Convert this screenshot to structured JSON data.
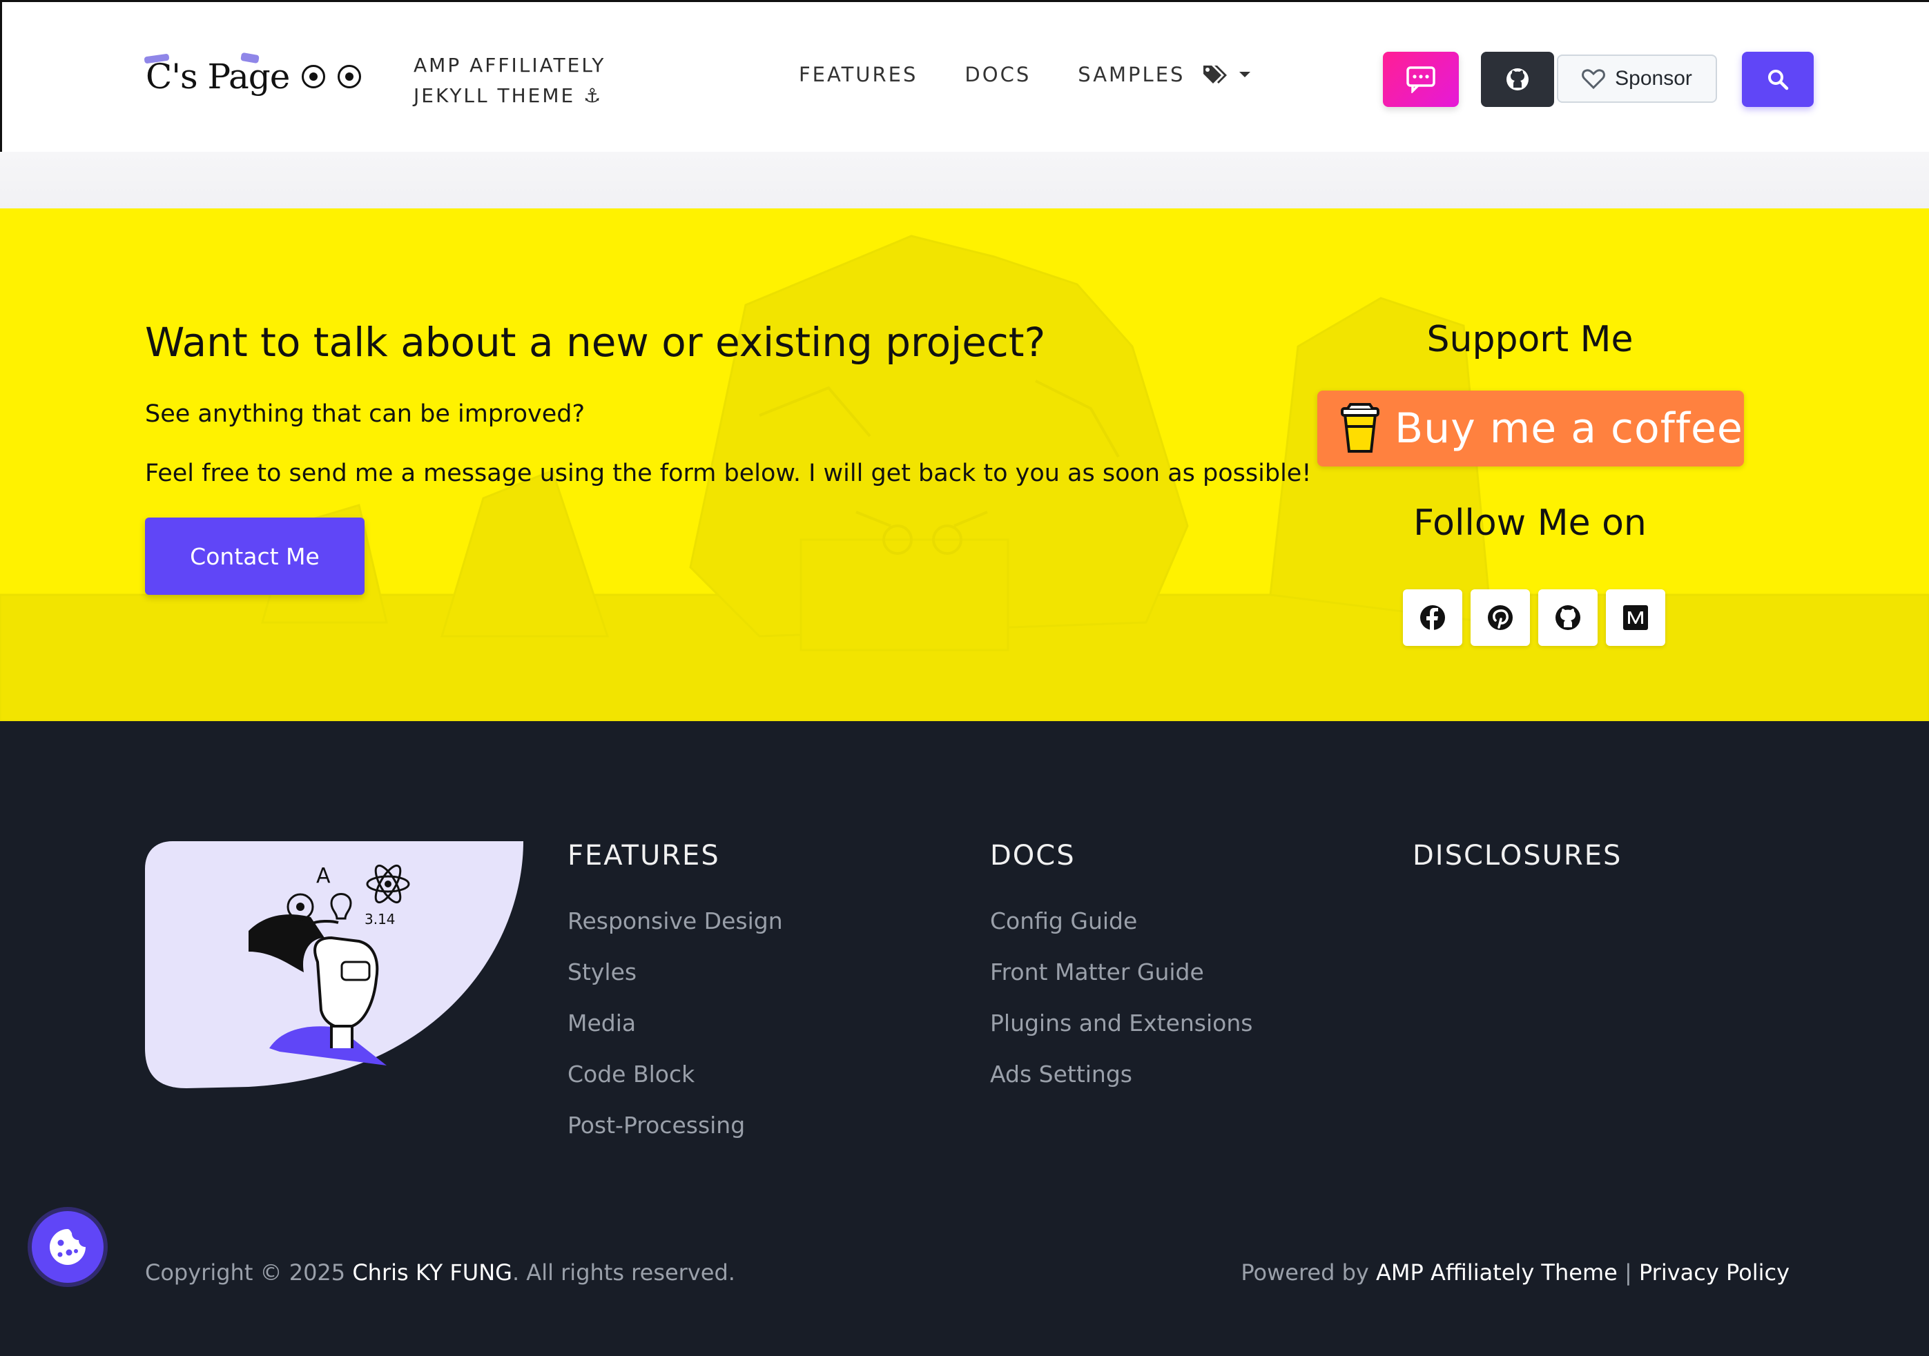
{
  "header": {
    "logo_text": "C's Page",
    "tagline_line1": "AMP AFFILIATELY",
    "tagline_line2": "JEKYLL THEME ⚓",
    "nav": [
      {
        "label": "FEATURES"
      },
      {
        "label": "DOCS"
      },
      {
        "label": "SAMPLES"
      }
    ],
    "sponsor_label": "Sponsor",
    "icons": {
      "tags": "tags-icon",
      "chat": "chat-icon",
      "github": "github-icon",
      "heart": "heart-icon",
      "search": "search-icon"
    }
  },
  "hero": {
    "title": "Want to talk about a new or existing project?",
    "line1": "See anything that can be improved?",
    "line2": "Feel free to send me a message using the form below. I will get back to you as soon as possible!",
    "contact_label": "Contact Me",
    "support_title": "Support Me",
    "coffee_label": "Buy me a coffee",
    "follow_title": "Follow Me on",
    "social": [
      "facebook-icon",
      "pinterest-icon",
      "github-icon",
      "medium-icon"
    ]
  },
  "footer": {
    "columns": [
      {
        "heading": "FEATURES",
        "links": [
          "Responsive Design",
          "Styles",
          "Media",
          "Code Block",
          "Post-Processing"
        ]
      },
      {
        "heading": "DOCS",
        "links": [
          "Config Guide",
          "Front Matter Guide",
          "Plugins and Extensions",
          "Ads Settings"
        ]
      },
      {
        "heading": "DISCLOSURES",
        "links": []
      }
    ],
    "copyright_prefix": "Copyright © 2025 ",
    "copyright_name": "Chris KY FUNG",
    "copyright_suffix": ". All rights reserved.",
    "powered_prefix": "Powered by ",
    "powered_theme": "AMP Affiliately Theme",
    "powered_sep": " | ",
    "privacy_label": "Privacy Policy",
    "cookie_icon": "cookie-icon"
  },
  "colors": {
    "accent": "#6046f7",
    "hero_bg": "#fff200",
    "footer_bg": "#181d27",
    "coffee": "#ff813f",
    "chat_gradient_start": "#ff1f95"
  }
}
